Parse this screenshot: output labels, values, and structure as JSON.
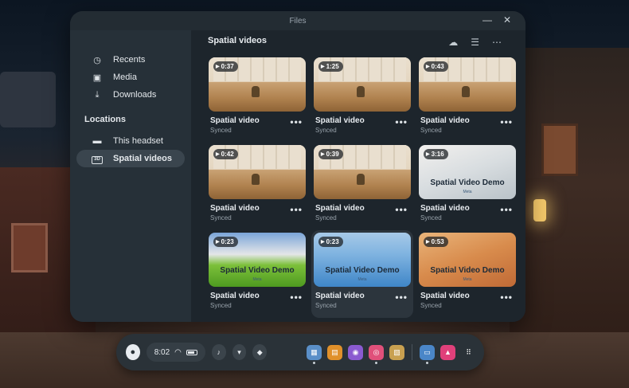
{
  "window": {
    "title": "Files"
  },
  "sidebar": {
    "items": [
      {
        "label": "Recents",
        "icon": "clock-icon"
      },
      {
        "label": "Media",
        "icon": "media-icon"
      },
      {
        "label": "Downloads",
        "icon": "download-icon"
      }
    ],
    "locations_heading": "Locations",
    "locations": [
      {
        "label": "This headset",
        "icon": "folder-icon"
      },
      {
        "label": "Spatial videos",
        "icon": "spatial-video-icon",
        "active": true
      }
    ]
  },
  "main": {
    "title": "Spatial videos",
    "videos": [
      {
        "duration": "0:37",
        "title": "Spatial video",
        "status": "Synced"
      },
      {
        "duration": "1:25",
        "title": "Spatial video",
        "status": "Synced"
      },
      {
        "duration": "0:43",
        "title": "Spatial video",
        "status": "Synced"
      },
      {
        "duration": "0:42",
        "title": "Spatial video",
        "status": "Synced"
      },
      {
        "duration": "0:39",
        "title": "Spatial video",
        "status": "Synced"
      },
      {
        "duration": "3:16",
        "title": "Spatial video",
        "status": "Synced",
        "overlay": "Spatial Video Demo",
        "overlay_sub": "Meta"
      },
      {
        "duration": "0:23",
        "title": "Spatial video",
        "status": "Synced",
        "overlay": "Spatial Video Demo",
        "overlay_sub": "Meta"
      },
      {
        "duration": "0:23",
        "title": "Spatial video",
        "status": "Synced",
        "overlay": "Spatial Video Demo",
        "overlay_sub": "Meta"
      },
      {
        "duration": "0:53",
        "title": "Spatial video",
        "status": "Synced",
        "overlay": "Spatial Video Demo",
        "overlay_sub": "Meta"
      }
    ]
  },
  "taskbar": {
    "time": "8:02",
    "apps": [
      {
        "name": "store",
        "color": "#5a8fc8"
      },
      {
        "name": "shop",
        "color": "#e0902a"
      },
      {
        "name": "people",
        "color": "#8a5ad0"
      },
      {
        "name": "camera",
        "color": "#e0507a"
      },
      {
        "name": "photo",
        "color": "#c8a050"
      },
      {
        "name": "files",
        "color": "#4a86c8"
      },
      {
        "name": "games",
        "color": "#e0407a"
      }
    ]
  }
}
